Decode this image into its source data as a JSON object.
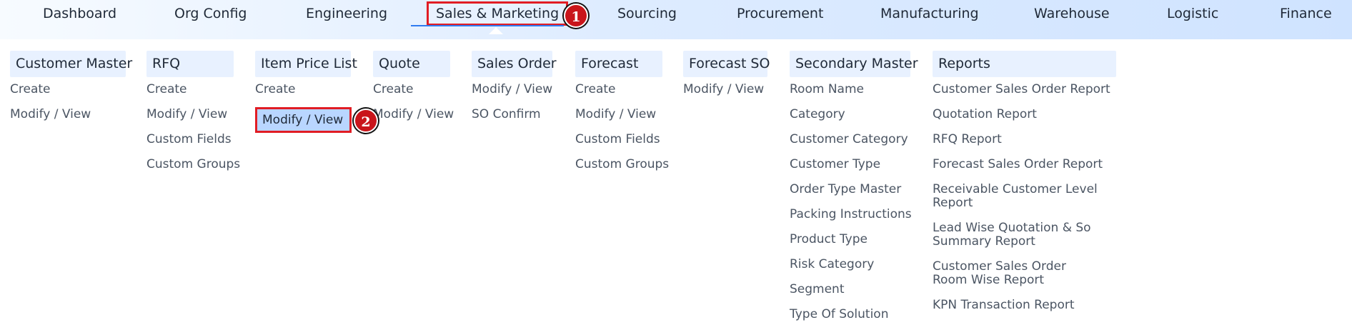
{
  "nav": {
    "items": [
      {
        "label": "Dashboard"
      },
      {
        "label": "Org Config"
      },
      {
        "label": "Engineering"
      },
      {
        "label": "Sales & Marketing"
      },
      {
        "label": "Sourcing"
      },
      {
        "label": "Procurement"
      },
      {
        "label": "Manufacturing"
      },
      {
        "label": "Warehouse"
      },
      {
        "label": "Logistic"
      },
      {
        "label": "Finance"
      }
    ]
  },
  "annotations": {
    "badge_1": "1",
    "badge_2": "2"
  },
  "colors": {
    "highlight_border": "#e11d24",
    "selected_fill": "#b9d6ff",
    "header_bg": "#e8f1ff",
    "nav_gradient_end": "#cfe3ff"
  },
  "menu": {
    "customer_master": {
      "title": "Customer Master",
      "items": [
        "Create",
        "Modify / View"
      ]
    },
    "rfq": {
      "title": "RFQ",
      "items": [
        "Create",
        "Modify / View",
        "Custom Fields",
        "Custom Groups"
      ]
    },
    "item_price_list": {
      "title": "Item Price List",
      "items": [
        "Create",
        "Modify / View"
      ]
    },
    "quote": {
      "title": "Quote",
      "items": [
        "Create",
        "Modify / View"
      ]
    },
    "sales_order": {
      "title": "Sales Order",
      "items": [
        "Modify / View",
        "SO Confirm"
      ]
    },
    "forecast": {
      "title": "Forecast",
      "items": [
        "Create",
        "Modify / View",
        "Custom Fields",
        "Custom Groups"
      ]
    },
    "forecast_so": {
      "title": "Forecast SO",
      "items": [
        "Modify / View"
      ]
    },
    "secondary_master": {
      "title": "Secondary Master",
      "items": [
        "Room Name",
        "Category",
        "Customer Category",
        "Customer Type",
        "Order Type Master",
        "Packing Instructions",
        "Product Type",
        "Risk Category",
        "Segment",
        "Type Of Solution"
      ]
    },
    "reports": {
      "title": "Reports",
      "items": [
        "Customer Sales Order Report",
        "Quotation Report",
        "RFQ Report",
        "Forecast Sales Order Report",
        "Receivable Customer Level Report",
        "Lead Wise Quotation & So Summary Report",
        "Customer Sales Order Room Wise Report",
        "KPN Transaction Report"
      ]
    }
  }
}
